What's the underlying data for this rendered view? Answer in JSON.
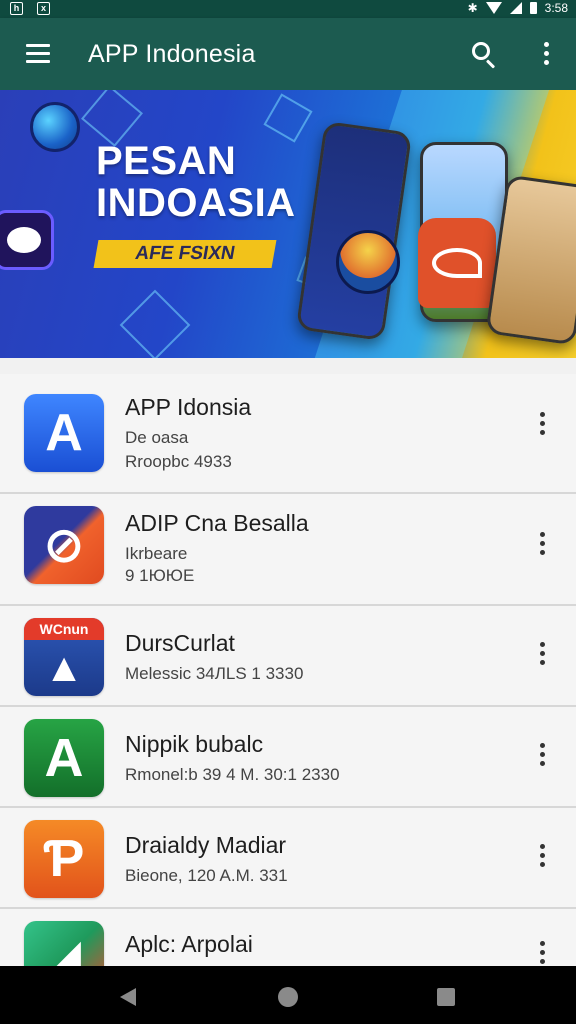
{
  "status_bar": {
    "time": "3:58"
  },
  "app_bar": {
    "title": "APP Indonesia"
  },
  "banner": {
    "heading_line1": "PESAN",
    "heading_line2": "INDOASIA",
    "subtitle": "AFE FSIXN"
  },
  "list": {
    "items": [
      {
        "name": "APP Idonsia",
        "line2": "De oasa",
        "line3": "Rroopbc 4933",
        "icon": "letter-a-app-icon",
        "color": "#1e63e9"
      },
      {
        "name": "ADIP Cna Besalla",
        "line2": "Ikrbeare",
        "line3": "9 1ЮЮЕ",
        "icon": "blocked-circle-app-icon",
        "color": "#e0552b"
      },
      {
        "name": "DursCurlat",
        "line2": "Melessic 34ЛLS 1 3330",
        "line3": "",
        "icon": "tower-app-icon",
        "color": "#2d58b8"
      },
      {
        "name": "Nippik bubalc",
        "line2": "Rmonel:b 39 4 M. 30:1 2330",
        "line3": "",
        "icon": "arrow-a-app-icon",
        "color": "#1d8a3a"
      },
      {
        "name": "Draialdy Madiar",
        "line2": "Bieone, 120 A.M. 331",
        "line3": "",
        "icon": "letter-p-app-icon",
        "color": "#ee6a1c"
      },
      {
        "name": "Aplc: Arpolai",
        "line2": "",
        "line3": "",
        "icon": "triangle-app-icon",
        "color": "#2fb06a"
      }
    ]
  },
  "nav_bar": {
    "back": "back",
    "home": "home",
    "recents": "recents"
  }
}
